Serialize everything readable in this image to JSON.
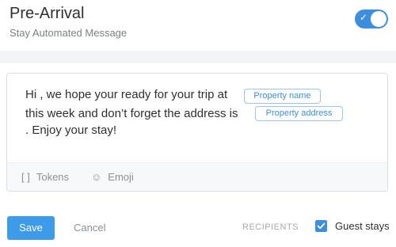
{
  "header": {
    "title": "Pre-Arrival",
    "subtitle": "Stay Automated Message",
    "toggle_on": true
  },
  "message": {
    "line1": "Hi , we hope your ready for your trip at",
    "line2": "this week and don’t forget the address is",
    "line3": ". Enjoy your stay!",
    "tokens": [
      "Property name",
      "Property address"
    ]
  },
  "composer_toolbar": {
    "tokens_label": "Tokens",
    "emoji_label": "Emoji"
  },
  "footer": {
    "save_label": "Save",
    "cancel_label": "Cancel",
    "recipients_label": "RECIPIENTS",
    "guest_stays_label": "Guest stays",
    "guest_stays_checked": true
  },
  "colors": {
    "accent": "#3d8fde",
    "save_button": "#3d9be9"
  }
}
